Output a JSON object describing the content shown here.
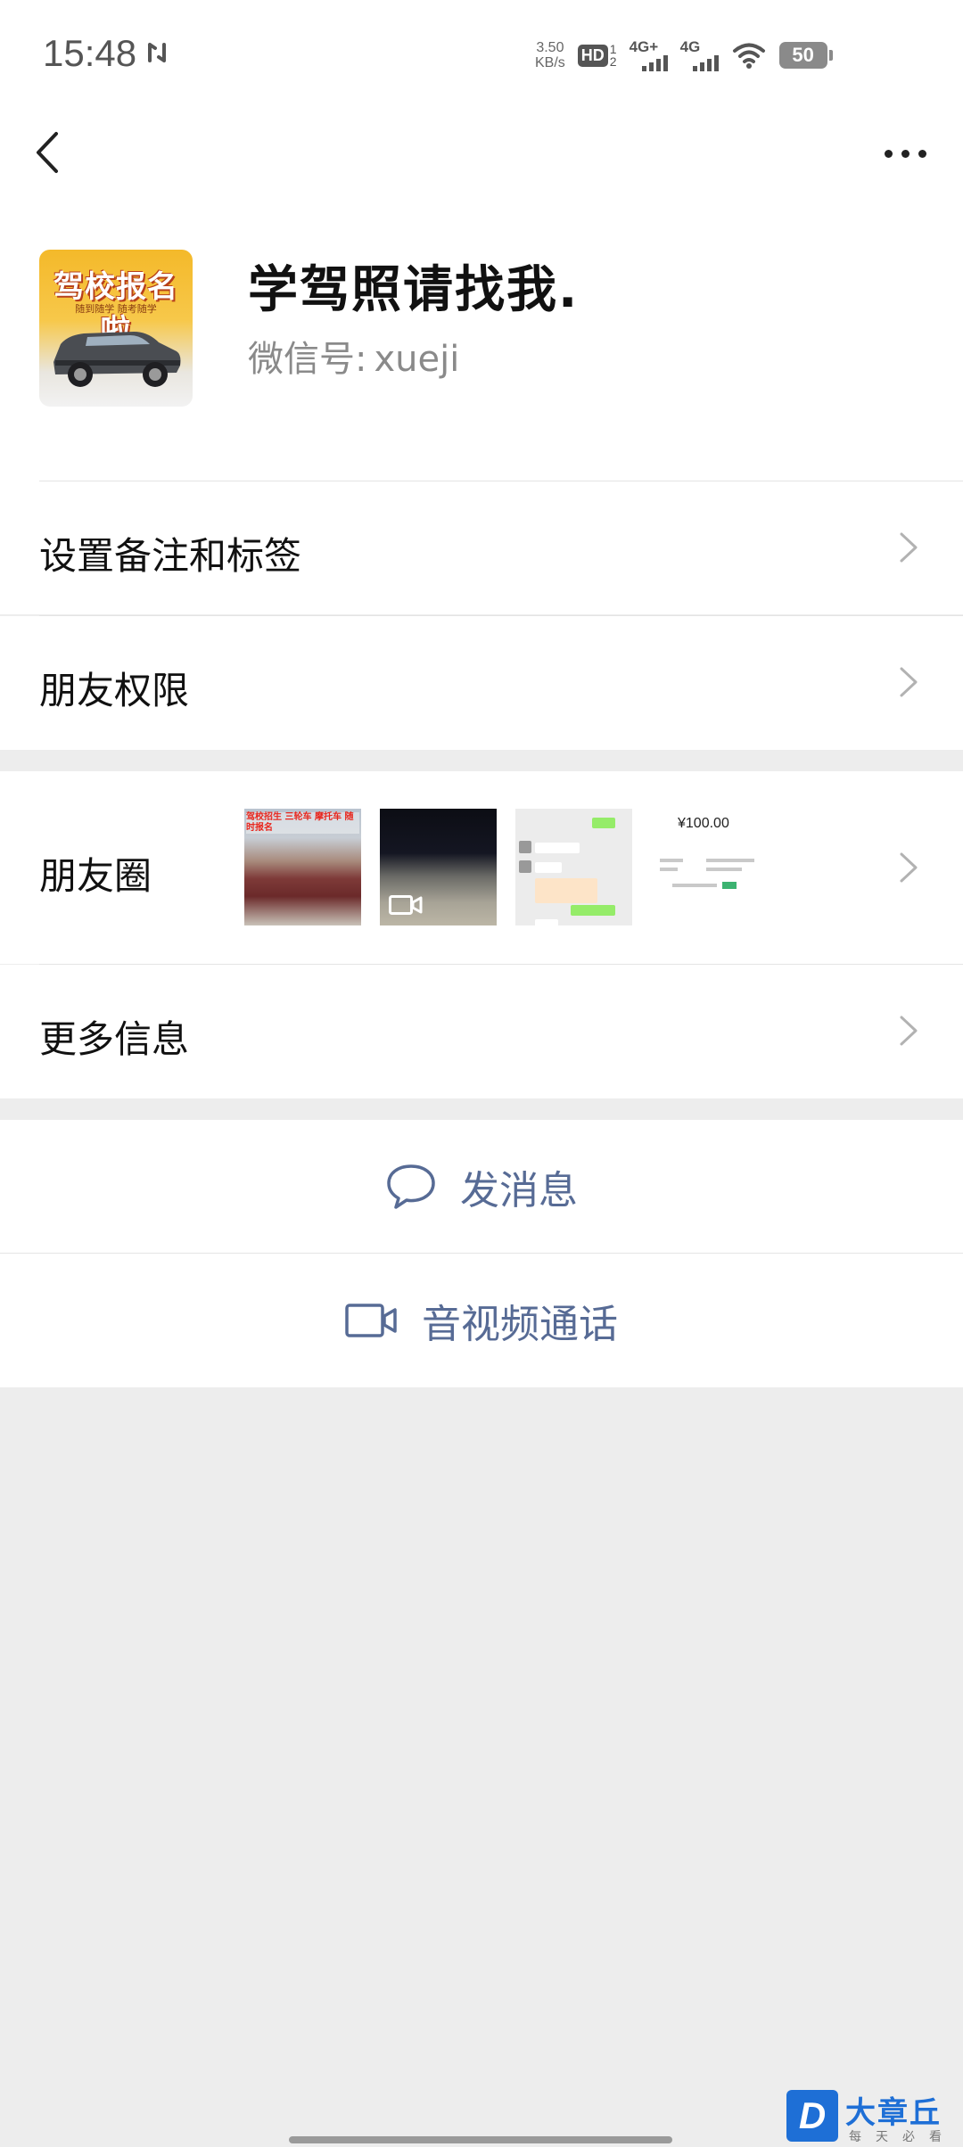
{
  "status_bar": {
    "time": "15:48",
    "net_speed": "3.50",
    "net_speed_unit": "KB/s",
    "hd_label": "HD",
    "hd_sim_top": "1",
    "hd_sim_bottom": "2",
    "sim1_type": "4G+",
    "sim2_type": "4G",
    "battery_level": "50",
    "icons": [
      "sync-icon",
      "signal-icon",
      "wifi-icon",
      "battery-icon"
    ]
  },
  "nav": {
    "back_icon": "chevron-left-icon",
    "more_icon": "more-dots-icon"
  },
  "profile": {
    "avatar_text": "驾校报名啦",
    "avatar_subtext": "随到随学 随考随学",
    "display_name": "学驾照请找我.",
    "wechat_id_label": "微信号:",
    "wechat_id_value": "xueji"
  },
  "menu": {
    "remark_tags": "设置备注和标签",
    "friend_permissions": "朋友权限",
    "moments": "朋友圈",
    "more_info": "更多信息"
  },
  "moments_thumbs": {
    "thumb1_caption": "驾校招生 三轮车 摩托车 随时报名",
    "thumb4_amount": "¥100.00"
  },
  "actions": {
    "send_message": "发消息",
    "video_call": "音视频通话"
  },
  "watermark": {
    "logo_letter": "D",
    "name": "大章丘",
    "slogan": "每天必看"
  },
  "colors": {
    "link_blue": "#576b95",
    "background": "#ededed",
    "card": "#ffffff"
  }
}
